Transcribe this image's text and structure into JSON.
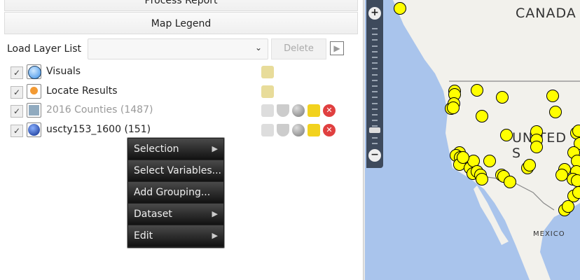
{
  "panel": {
    "process_report": "Process Report",
    "map_legend": "Map Legend",
    "load_layer_label": "Load Layer List",
    "load_layer_value": "",
    "delete_label": "Delete"
  },
  "layers": [
    {
      "name": "Visuals",
      "checked": true,
      "icon": "blue-globe-icon"
    },
    {
      "name": "Locate Results",
      "checked": true,
      "icon": "pushpin-icon"
    },
    {
      "name": "2016 Counties (1487)",
      "checked": true,
      "icon": "polygon-icon",
      "dimmed": true
    },
    {
      "name": "uscty153_1600 (151)",
      "checked": true,
      "icon": "dark-globe-icon"
    }
  ],
  "context_menu": [
    {
      "label": "Selection",
      "submenu": true
    },
    {
      "label": "Select Variables...",
      "submenu": false
    },
    {
      "label": "Add Grouping...",
      "submenu": false
    },
    {
      "label": "Dataset",
      "submenu": true
    },
    {
      "label": "Edit",
      "submenu": true
    }
  ],
  "map": {
    "labels": {
      "canada": "CANADA",
      "us": "UNITED S",
      "mexico": "MEXICO"
    },
    "marker_color": "#ffff00",
    "water_color": "#a9c4ec",
    "land_color": "#f2f1ec"
  }
}
